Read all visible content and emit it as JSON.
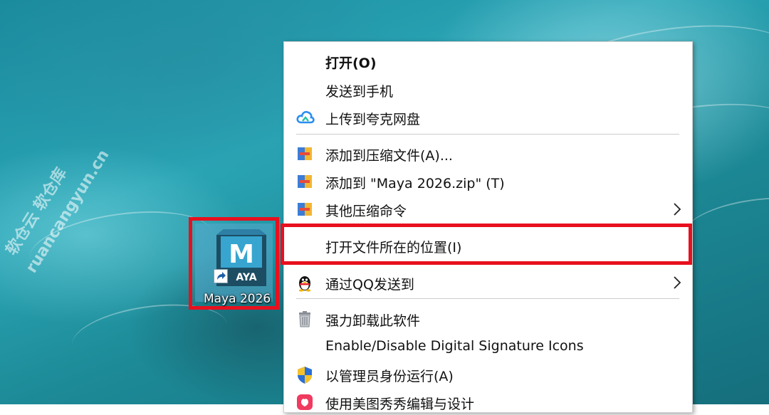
{
  "desktop": {
    "watermark_line1": "软仓云 软仓库",
    "watermark_line2": "ruancangyun.cn",
    "shortcut": {
      "label": "Maya 2026",
      "logo_letter": "M",
      "logo_subtext": "AYA",
      "icon": "maya-app-icon"
    }
  },
  "menu": {
    "items": [
      {
        "label": "打开(O)",
        "icon": null
      },
      {
        "label": "发送到手机",
        "icon": null
      },
      {
        "label": "上传到夸克网盘",
        "icon": "quark-cloud-icon"
      },
      {
        "label": "添加到压缩文件(A)...",
        "icon": "archive-icon"
      },
      {
        "label": "添加到 \"Maya 2026.zip\" (T)",
        "icon": "archive-icon"
      },
      {
        "label": "其他压缩命令",
        "icon": "archive-icon",
        "submenu": true
      },
      {
        "label": "打开文件所在的位置(I)",
        "icon": null
      },
      {
        "label": "通过QQ发送到",
        "icon": "qq-penguin-icon",
        "submenu": true
      },
      {
        "label": "强力卸载此软件",
        "icon": "trash-icon"
      },
      {
        "label": "Enable/Disable Digital Signature Icons",
        "icon": null
      },
      {
        "label": "以管理员身份运行(A)",
        "icon": "admin-shield-icon"
      },
      {
        "label": "使用美图秀秀编辑与设计",
        "icon": "meitu-icon"
      }
    ]
  },
  "colors": {
    "highlight": "#e8101e",
    "menu_bg": "#ffffff",
    "quark_blue": "#2a8ef0"
  }
}
